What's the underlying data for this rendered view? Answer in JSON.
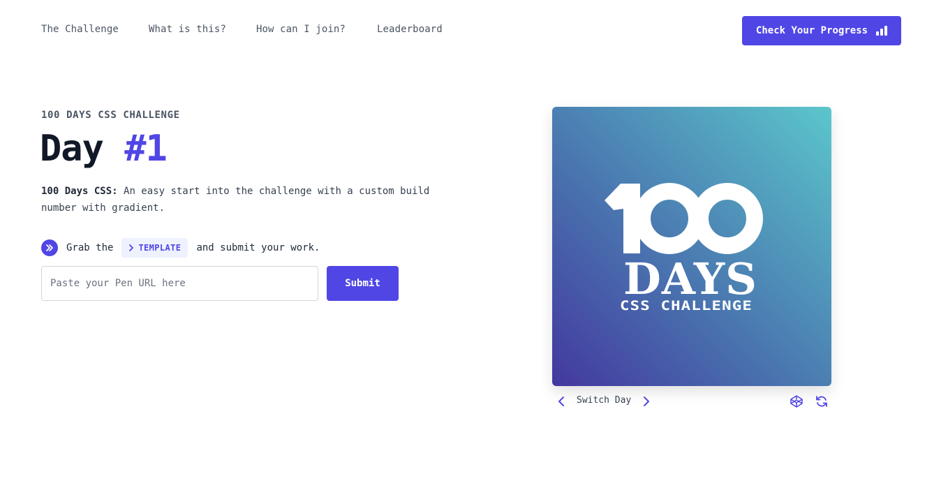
{
  "nav": {
    "links": [
      "The Challenge",
      "What is this?",
      "How can I join?",
      "Leaderboard"
    ],
    "cta_label": "Check Your Progress"
  },
  "hero": {
    "eyebrow": "100 DAYS CSS CHALLENGE",
    "title_prefix": "Day",
    "title_accent": "#1",
    "desc_bold": "100 Days CSS:",
    "desc_text": "An easy start into the challenge with a custom build number with gradient.",
    "grab_prefix": "Grab the",
    "template_label": "TEMPLATE",
    "grab_suffix": "and submit your work.",
    "input_placeholder": "Paste your Pen URL here",
    "submit_label": "Submit"
  },
  "preview": {
    "big_number": "100",
    "days_text": "DAYS",
    "sub_text": "CSS CHALLENGE",
    "gradient_start": "#43389f",
    "gradient_end": "#5bc6cb",
    "switch_label": "Switch Day"
  },
  "colors": {
    "accent": "#5046e5",
    "heading": "#111827",
    "muted": "#4b5563"
  }
}
